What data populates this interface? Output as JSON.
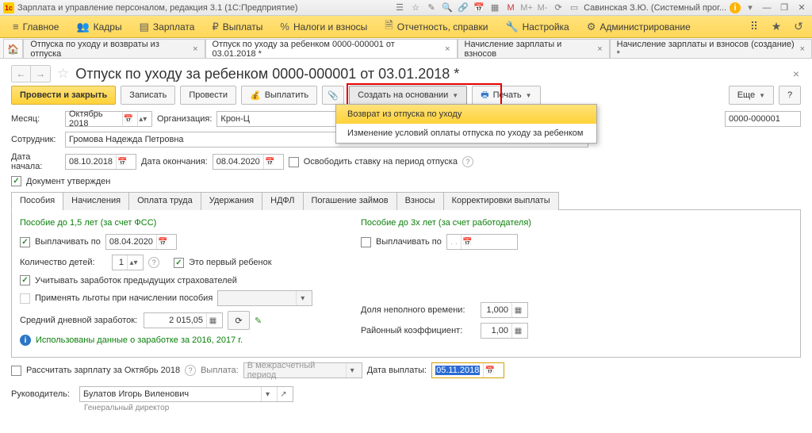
{
  "titlebar": {
    "app": "Зарплата и управление персоналом, редакция 3.1  (1С:Предприятие)",
    "user": "Савинская З.Ю. (Системный прог..."
  },
  "menu": {
    "items": [
      {
        "icon": "≡",
        "label": "Главное"
      },
      {
        "icon": "👥",
        "label": "Кадры"
      },
      {
        "icon": "▤",
        "label": "Зарплата"
      },
      {
        "icon": "₽",
        "label": "Выплаты"
      },
      {
        "icon": "%",
        "label": "Налоги и взносы"
      },
      {
        "icon": "🗎",
        "label": "Отчетность, справки"
      },
      {
        "icon": "🔧",
        "label": "Настройка"
      },
      {
        "icon": "⚙",
        "label": "Администрирование"
      }
    ]
  },
  "tabs": {
    "items": [
      {
        "label": "Отпуска по уходу и возвраты из отпуска",
        "active": false,
        "close": true
      },
      {
        "label": "Отпуск по уходу за ребенком 0000-000001 от 03.01.2018 *",
        "active": true,
        "close": true
      },
      {
        "label": "Начисление зарплаты и взносов",
        "active": false,
        "close": true
      },
      {
        "label": "Начисление зарплаты и взносов (создание) *",
        "active": false,
        "close": true
      }
    ]
  },
  "doc": {
    "title": "Отпуск по уходу за ребенком 0000-000001 от 03.01.2018 *"
  },
  "toolbar": {
    "post_close": "Провести и закрыть",
    "write": "Записать",
    "post": "Провести",
    "pay": "Выплатить",
    "create_on_basis": "Создать на основании",
    "print": "Печать",
    "more": "Еще",
    "help": "?"
  },
  "dropdown": {
    "item1": "Возврат из отпуска по уходу",
    "item2": "Изменение условий оплаты отпуска по уходу за ребенком"
  },
  "form": {
    "month_lbl": "Месяц:",
    "month_val": "Октябрь 2018",
    "org_lbl": "Организация:",
    "org_val": "Крон-Ц",
    "num_val": "0000-000001",
    "emp_lbl": "Сотрудник:",
    "emp_val": "Громова Надежда Петровна",
    "start_lbl": "Дата начала:",
    "start_val": "08.10.2018",
    "end_lbl": "Дата окончания:",
    "end_val": "08.04.2020",
    "free_rate": "Освободить ставку на период отпуска",
    "approved": "Документ утвержден"
  },
  "itabs": [
    "Пособия",
    "Начисления",
    "Оплата труда",
    "Удержания",
    "НДФЛ",
    "Погашение займов",
    "Взносы",
    "Корректировки выплаты"
  ],
  "panel": {
    "leftTitle": "Пособие до 1,5 лет (за счет ФСС)",
    "rightTitle": "Пособие до 3х лет (за счет работодателя)",
    "pay_until": "Выплачивать по",
    "pay_until_val": "08.04.2020",
    "pay_until_empty": "  .  .",
    "children_lbl": "Количество детей:",
    "children_val": "1",
    "first_child": "Это первый ребенок",
    "prev_ins": "Учитывать заработок предыдущих страхователей",
    "apply_ben": "Применять льготы при начислении пособия",
    "avg_lbl": "Средний дневной заработок:",
    "avg_val": "2 015,05",
    "used_data": "Использованы данные о заработке за  2016,  2017 г.",
    "part_lbl": "Доля неполного времени:",
    "part_val": "1,000",
    "region_lbl": "Районный коэффициент:",
    "region_val": "1,00"
  },
  "bottom": {
    "calc": "Рассчитать зарплату за Октябрь 2018",
    "pay_lbl": "Выплата:",
    "pay_val": "В межрасчетный период",
    "date_lbl": "Дата выплаты:",
    "date_val": "05.11.2018"
  },
  "footer": {
    "head_lbl": "Руководитель:",
    "head_val": "Булатов Игорь Виленович",
    "head_pos": "Генеральный директор"
  }
}
